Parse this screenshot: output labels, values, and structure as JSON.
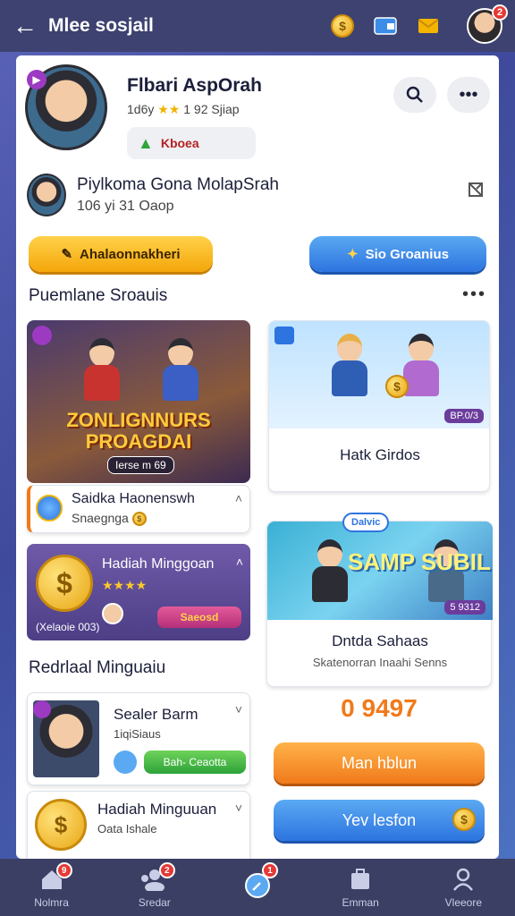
{
  "header": {
    "title": "Mlee sosjail",
    "notification_count": "2"
  },
  "profile": {
    "name": "Flbari AspOrah",
    "stats": "1d6y",
    "stats_tail": "1 92 Sjiap",
    "level": "Kboea"
  },
  "friend": {
    "name": "Piylkoma Gona MolapSrah",
    "subtitle": "106 yi 31 Oaop"
  },
  "actions": {
    "primary": "Ahalaonnakheri",
    "secondary": "Sio Groanius"
  },
  "sections": {
    "popular": "Puemlane Sroauis",
    "weekly": "Redrlaal Minguaiu"
  },
  "cards": {
    "promo": {
      "banner": "ZONLIGNNURS PROAGDAI",
      "pill": "Ierse m 69"
    },
    "store": {
      "label": "Hatk Girdos",
      "price": "BP.0/3"
    },
    "hadiah_small": {
      "title": "Saidka Haonenswh",
      "subtitle": "Snaegnga"
    },
    "hadiah_purple": {
      "title": "Hadiah Minggoan",
      "stars": "★★★★",
      "button": "Saeosd",
      "caption": "(Xelaoie 003)"
    },
    "showcase": {
      "pin": "Dalvic",
      "stamp": "SAMP SUBIL",
      "price": "5 9312",
      "title": "Dntda Sahaas",
      "subtitle": "Skatenorran Inaahi Senns"
    }
  },
  "list": {
    "item1": {
      "title": "Sealer Barm",
      "subtitle": "1iqiSiaus",
      "button": "Bah- Ceaotta"
    },
    "item2": {
      "title": "Hadiah Minguuan",
      "subtitle": "Oata Ishale"
    }
  },
  "score": "0 9497",
  "buttons": {
    "orange": "Man hblun",
    "blue": "Yev lesfon"
  },
  "bottom_nav": [
    {
      "label": "Nolmra",
      "badge": "9"
    },
    {
      "label": "Sredar",
      "badge": "2"
    },
    {
      "label": "",
      "badge": "1"
    },
    {
      "label": "Emman",
      "badge": ""
    },
    {
      "label": "Vleeore",
      "badge": ""
    }
  ]
}
